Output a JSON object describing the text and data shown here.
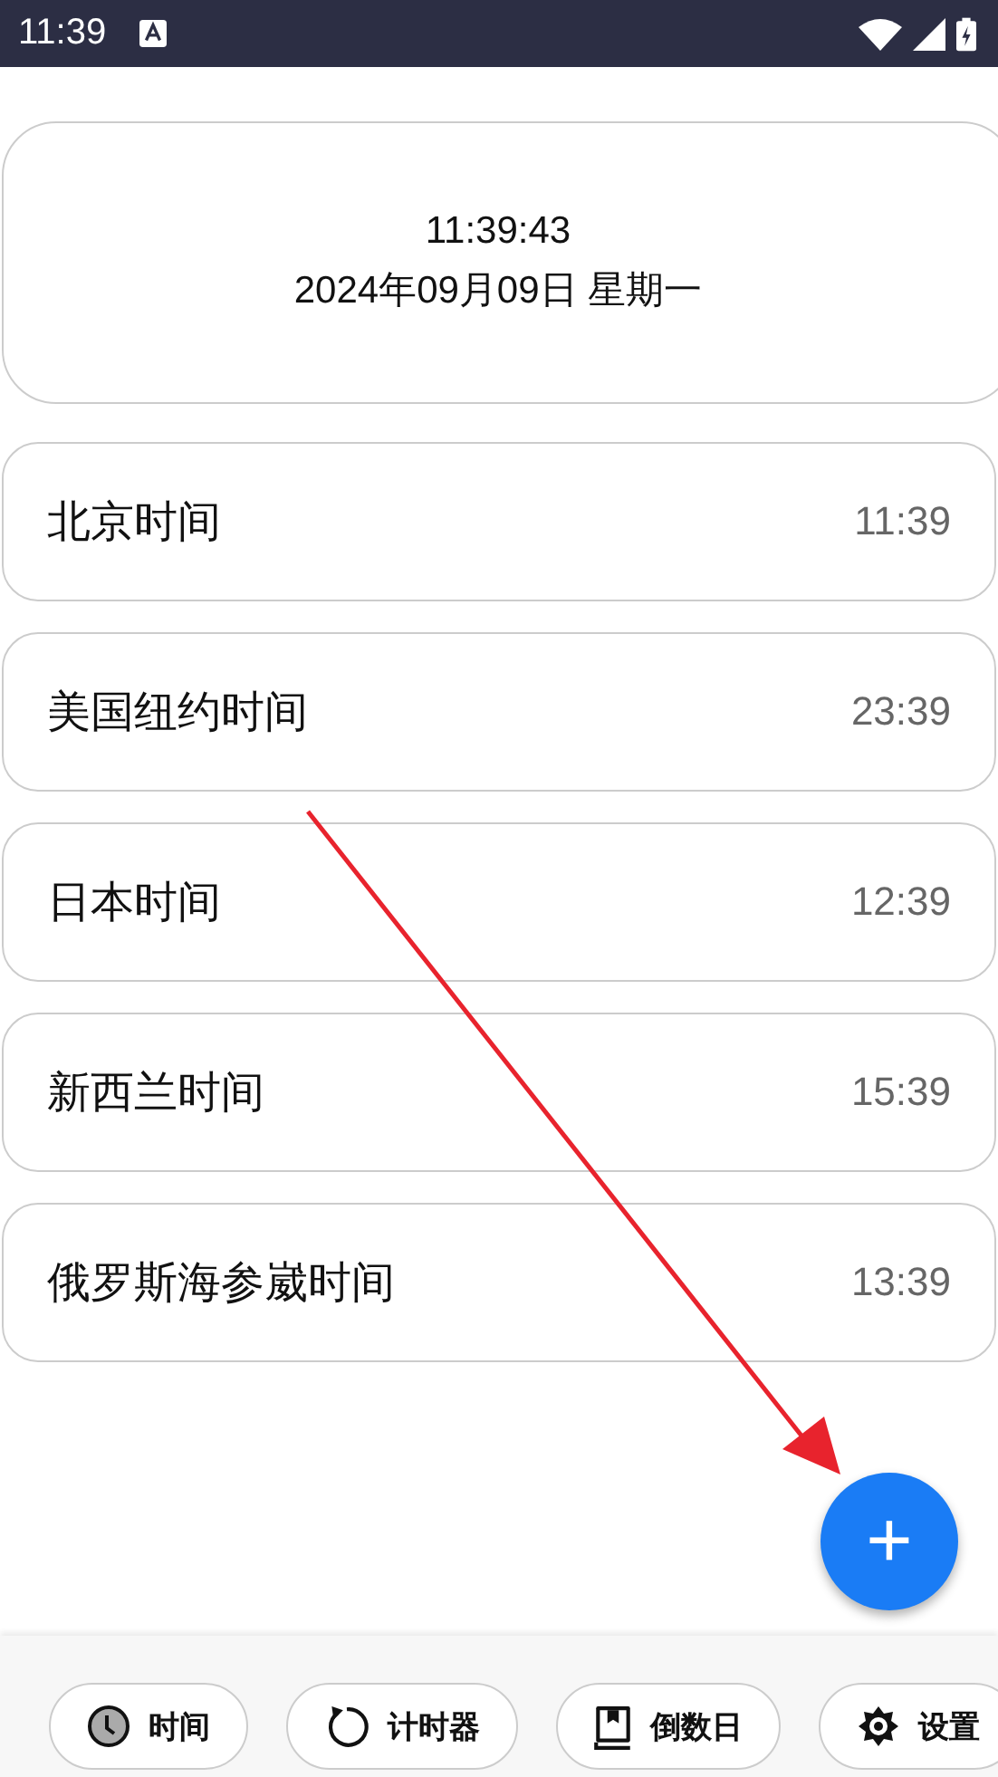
{
  "status_bar": {
    "time": "11:39"
  },
  "clock": {
    "time": "11:39:43",
    "date": "2024年09月09日 星期一"
  },
  "zones": [
    {
      "name": "北京时间",
      "time": "11:39"
    },
    {
      "name": "美国纽约时间",
      "time": "23:39"
    },
    {
      "name": "日本时间",
      "time": "12:39"
    },
    {
      "name": "新西兰时间",
      "time": "15:39"
    },
    {
      "name": "俄罗斯海参崴时间",
      "time": "13:39"
    }
  ],
  "fab": {
    "label": "+"
  },
  "nav": [
    {
      "kind": "clock",
      "label": "时间"
    },
    {
      "kind": "timer",
      "label": "计时器"
    },
    {
      "kind": "book",
      "label": "倒数日"
    },
    {
      "kind": "gear",
      "label": "设置"
    }
  ]
}
